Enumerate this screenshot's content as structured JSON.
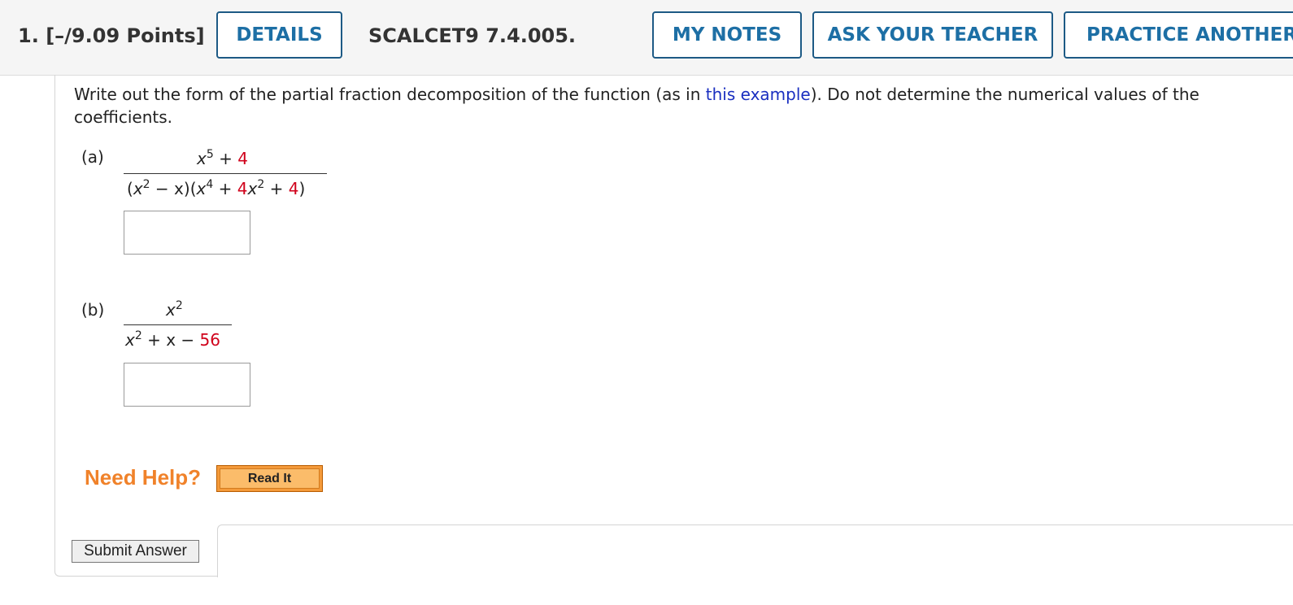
{
  "header": {
    "question_number": "1.",
    "points": "[–/9.09 Points]",
    "details_label": "DETAILS",
    "question_id": "SCALCET9 7.4.005.",
    "my_notes_label": "MY NOTES",
    "ask_teacher_label": "ASK YOUR TEACHER",
    "practice_label": "PRACTICE ANOTHER"
  },
  "prompt": {
    "before_link": "Write out the form of the partial fraction decomposition of the function (as in ",
    "link": "this example",
    "after_link": "). Do not determine the numerical values of the coefficients."
  },
  "parts": {
    "a": {
      "label": "(a)",
      "num": {
        "var": "x",
        "exp": "5",
        "op": " + ",
        "const": "4"
      },
      "den": {
        "f1_open": "(",
        "f1_var": "x",
        "f1_exp": "2",
        "f1_rest": " − x)",
        "f2_open": "(",
        "f2_var": "x",
        "f2_exp": "4",
        "f2_op": " + ",
        "f2_coef": "4",
        "f2_var2": "x",
        "f2_exp2": "2",
        "f2_op2": " + ",
        "f2_const": "4",
        "f2_close": ")"
      },
      "answer_value": ""
    },
    "b": {
      "label": "(b)",
      "num": {
        "var": "x",
        "exp": "2"
      },
      "den": {
        "var": "x",
        "exp": "2",
        "rest": " + x − ",
        "const": "56"
      },
      "answer_value": ""
    }
  },
  "help": {
    "need_help_label": "Need Help?",
    "read_it_label": "Read It"
  },
  "submit_label": "Submit Answer",
  "colors": {
    "button_border": "#1d5a85",
    "button_text": "#1d6fa5",
    "link": "#1a2fc0",
    "given_constant": "#d0021b",
    "need_help": "#f0822a",
    "read_it_bg": "#f49a3a"
  }
}
